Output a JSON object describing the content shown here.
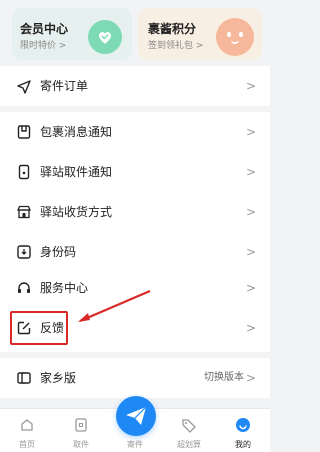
{
  "cards": {
    "left": {
      "title": "会员中心",
      "subtitle": "限时特价 >"
    },
    "right": {
      "title": "裹酱积分",
      "subtitle": "签到领礼包 >"
    }
  },
  "menu": {
    "group1": [
      {
        "label": "寄件订单",
        "icon": "send-icon"
      }
    ],
    "group2": [
      {
        "label": "包裹消息通知",
        "icon": "package-notice-icon"
      },
      {
        "label": "驿站取件通知",
        "icon": "phone-notice-icon"
      },
      {
        "label": "驿站收货方式",
        "icon": "station-icon"
      },
      {
        "label": "身份码",
        "icon": "id-code-icon"
      }
    ],
    "group3": [
      {
        "label": "服务中心",
        "icon": "headset-icon"
      },
      {
        "label": "反馈",
        "icon": "edit-feedback-icon"
      }
    ],
    "group4": [
      {
        "label": "家乡版",
        "icon": "hometown-icon",
        "extra": "切换版本"
      }
    ]
  },
  "arrow_glyph": ">",
  "tabbar": {
    "items": [
      {
        "label": "首页",
        "icon": "home-icon"
      },
      {
        "label": "取件",
        "icon": "pickup-icon"
      },
      {
        "label": "寄件",
        "icon": "send-paperplane-icon"
      },
      {
        "label": "超划算",
        "icon": "tag-icon"
      },
      {
        "label": "我的",
        "icon": "profile-icon",
        "active": true
      }
    ]
  },
  "colors": {
    "accent": "#1e88f5",
    "annotation_red": "#d92828"
  }
}
